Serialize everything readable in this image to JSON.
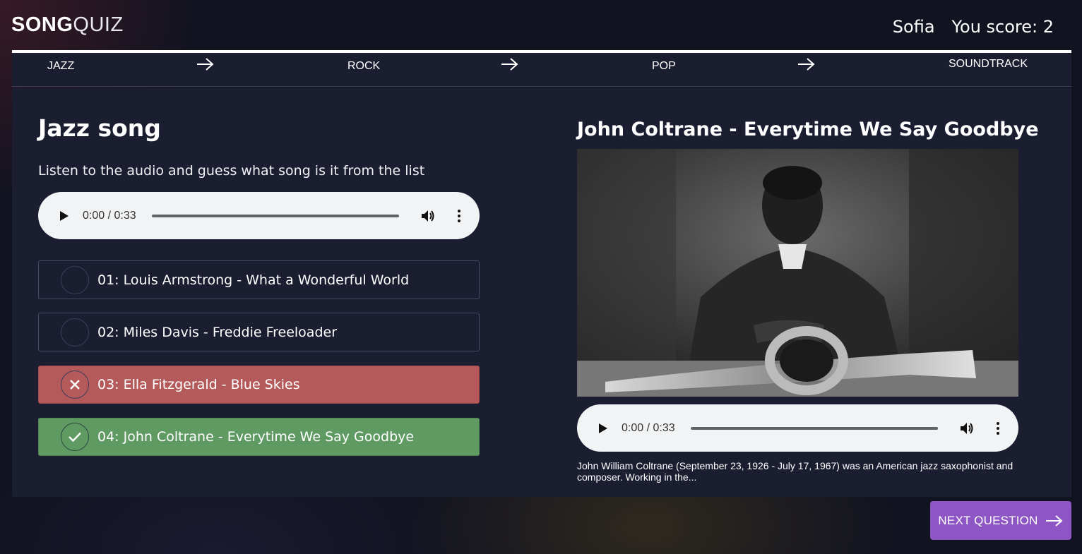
{
  "header": {
    "logo_bold": "SONG",
    "logo_light": "QUIZ",
    "player_name": "Sofia",
    "score_text": "You score: 2"
  },
  "categories": [
    "JAZZ",
    "ROCK",
    "POP",
    "SOUNDTRACK"
  ],
  "question": {
    "title": "Jazz song",
    "instruction": "Listen to the audio and guess what song is it from the list",
    "audio": {
      "time": "0:00 / 0:33"
    },
    "answers": [
      {
        "label": "01: Louis Armstrong - What a Wonderful World",
        "state": "none"
      },
      {
        "label": "02: Miles Davis - Freddie Freeloader",
        "state": "none"
      },
      {
        "label": "03: Ella Fitzgerald - Blue Skies",
        "state": "wrong"
      },
      {
        "label": "04: John Coltrane - Everytime We Say Goodbye",
        "state": "correct"
      }
    ]
  },
  "reveal": {
    "title": "John Coltrane - Everytime We Say Goodbye",
    "audio": {
      "time": "0:00 / 0:33"
    },
    "description": "John William Coltrane (September 23, 1926 - July 17, 1967) was an American jazz saxophonist and composer. Working in the..."
  },
  "next_button": {
    "label": "NEXT QUESTION"
  },
  "colors": {
    "wrong": "#b55a5a",
    "correct": "#5e9a62",
    "accent": "#8e56c4",
    "panel": "#1b1d30"
  }
}
